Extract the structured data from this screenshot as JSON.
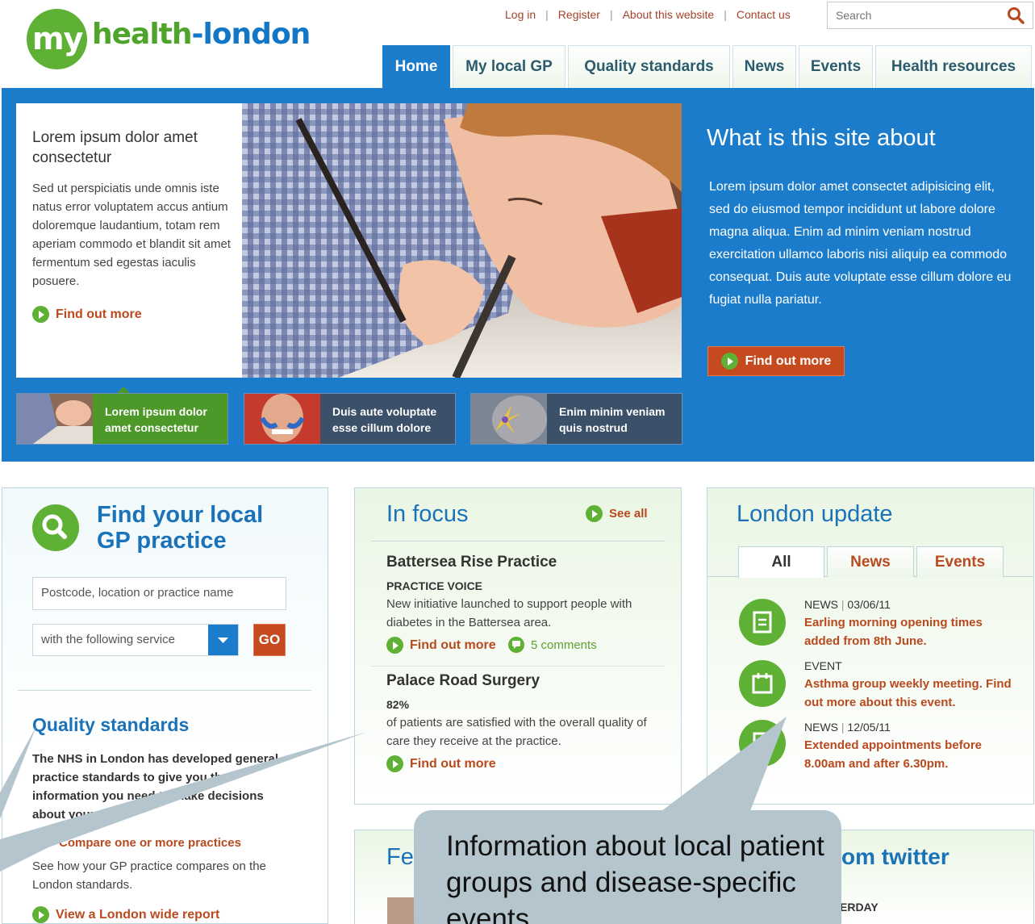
{
  "header": {
    "logo": {
      "my": "my",
      "health": "health",
      "dash": "-",
      "london": "london"
    },
    "top_links": [
      "Log in",
      "Register",
      "About this website",
      "Contact us"
    ],
    "search_placeholder": "Search"
  },
  "nav": {
    "tabs": [
      {
        "label": "Home",
        "active": true
      },
      {
        "label": "My local GP",
        "active": false
      },
      {
        "label": "Quality standards",
        "active": false
      },
      {
        "label": "News",
        "active": false
      },
      {
        "label": "Events",
        "active": false
      },
      {
        "label": "Health resources",
        "active": false
      }
    ]
  },
  "hero": {
    "card_title": "Lorem ipsum dolor amet consectetur",
    "card_text": "Sed ut perspiciatis unde omnis iste natus error voluptatem accus antium doloremque laudantium, totam rem aperiam commodo et blandit sit amet fermentum sed egestas iaculis posuere.",
    "card_link": "Find out more",
    "right_title": "What is this site about",
    "right_text": "Lorem ipsum dolor amet consectet adipisicing elit, sed do eiusmod tempor incididunt ut labore dolore magna aliqua. Enim ad minim veniam nostrud exercitation ullamco laboris nisi aliquip ea commodo consequat. Duis aute voluptate esse cillum dolore eu fugiat nulla pariatur.",
    "right_button": "Find out more",
    "thumbs": [
      {
        "line1": "Lorem ipsum dolor",
        "line2": "amet consectetur"
      },
      {
        "line1": "Duis aute voluptate",
        "line2": "esse cillum dolore"
      },
      {
        "line1": "Enim minim veniam",
        "line2": "quis nostrud"
      }
    ]
  },
  "gp_panel": {
    "title_line1": "Find your local",
    "title_line2": "GP practice",
    "location_placeholder": "Postcode, location or practice name",
    "service_value": "with the following service",
    "go_label": "GO",
    "qs_title": "Quality standards",
    "qs_text": "The NHS in London has developed general practice standards to give you the information you need to make decisions about your care.",
    "compare_link": "Compare one or more practices",
    "compare_text": "See how your GP practice compares on the London standards.",
    "report_link": "View a London wide report"
  },
  "in_focus": {
    "title": "In focus",
    "see_all": "See all",
    "items": [
      {
        "title": "Battersea Rise Practice",
        "sub": "PRACTICE VOICE",
        "text": "New initiative launched to support people with diabetes in the Battersea area.",
        "link": "Find out more",
        "comments": "5 comments"
      },
      {
        "title": "Palace Road Surgery",
        "sub": "82%",
        "text": "of patients are satisfied with the overall quality of care they receive at the practice.",
        "link": "Find out more"
      }
    ]
  },
  "london_update": {
    "title": "London update",
    "tabs": [
      "All",
      "News",
      "Events"
    ],
    "items": [
      {
        "type": "NEWS",
        "date": "03/06/11",
        "text": "Earling morning opening times added from 8th June."
      },
      {
        "type": "EVENT",
        "date": "",
        "text": "Asthma group weekly meeting. Find out more about this event."
      },
      {
        "type": "NEWS",
        "date": "12/05/11",
        "text": "Extended appointments before 8.00am and after 6.30pm."
      }
    ]
  },
  "bottom": {
    "featured_partial": "Fe",
    "twitter_partial": "om twitter",
    "twitter_day_partial": "ERDAY"
  },
  "callout": {
    "text": "Information about local patient groups and disease-specific events"
  },
  "colors": {
    "brand_green": "#5fb135",
    "brand_blue": "#1a7cca",
    "link_orange": "#b9491e",
    "callout_grey": "#b5c5ce"
  }
}
